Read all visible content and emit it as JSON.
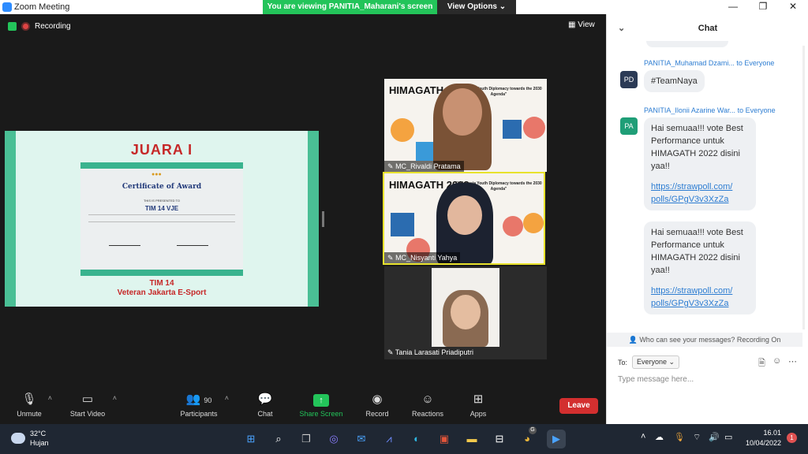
{
  "window": {
    "title": "Zoom Meeting",
    "minimize": "—",
    "restore": "❐",
    "close": "✕"
  },
  "banner": {
    "viewing": "You are viewing PANITIA_Maharani's screen",
    "view_options": "View Options ⌄"
  },
  "meeting": {
    "recording_label": "Recording",
    "view_label": "View",
    "shared_screen": {
      "heading": "JUARA I",
      "certificate_title": "Certificate of Award",
      "presented_to": "THIS IS PRESENTED TO",
      "recipient": "TIM 14 VJE",
      "team_line1": "TIM 14",
      "team_line2": "Veteran Jakarta E-Sport"
    },
    "participants": [
      {
        "name": "MC_Rivaldi Pratama",
        "event": "HIMAGATH 2022",
        "tagline": "\"Indonesia Youth Diplomacy towards the 2030 Agenda\""
      },
      {
        "name": "MC_Nisyanti Yahya",
        "event": "HIMAGATH 2022",
        "tagline": "\"Indonesia Youth Diplomacy towards the 2030 Agenda\""
      },
      {
        "name": "Tania Larasati Priadiputri"
      }
    ]
  },
  "toolbar": {
    "unmute": "Unmute",
    "start_video": "Start Video",
    "participants": "Participants",
    "participants_count": "90",
    "chat": "Chat",
    "share_screen": "Share Screen",
    "record": "Record",
    "reactions": "Reactions",
    "apps": "Apps",
    "leave": "Leave"
  },
  "chat": {
    "title": "Chat",
    "messages": [
      {
        "initials": "PD",
        "avatar_color": "#2b3a55",
        "sender": "PANITIA_Muhamad Dzami...",
        "to": "to Everyone",
        "text": "#TeamNaya"
      },
      {
        "initials": "PA",
        "avatar_color": "#1f9e77",
        "sender": "PANITIA_Ilonii Azarine War...",
        "to": "to Everyone",
        "text": "Hai semuaa!!! vote Best Performance untuk HIMAGATH 2022 disini yaa!!",
        "link1": "https://strawpoll.com/",
        "link2": "polls/GPgV3v3XzZa"
      },
      {
        "text": "Hai semuaa!!! vote Best Performance untuk HIMAGATH 2022 disini yaa!!",
        "link1": "https://strawpoll.com/",
        "link2": "polls/GPgV3v3XzZa"
      }
    ],
    "who_can_see": "Who can see your messages? Recording On",
    "to_label": "To:",
    "recipient": "Everyone",
    "placeholder": "Type message here..."
  },
  "taskbar": {
    "temperature": "32°C",
    "weather": "Hujan",
    "time": "16.01",
    "date": "10/04/2022",
    "notifications": "1",
    "chrome_badge": "G"
  },
  "colors": {
    "share_green": "#23c45a",
    "leave_red": "#d32f2f",
    "link_blue": "#2d7dd2",
    "active_speaker": "#e8e22c"
  }
}
